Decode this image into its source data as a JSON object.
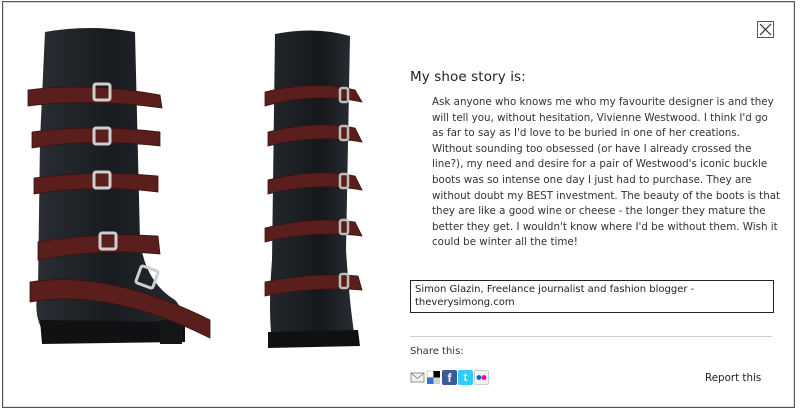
{
  "dialog": {
    "close_icon": "close-x-icon"
  },
  "story": {
    "heading": "My shoe story is:",
    "body": "Ask anyone who knows me who my favourite designer is and they will tell you, without hesitation, Vivienne Westwood. I think I'd go as far to say as I'd love to be buried in one of her creations. Without sounding too obsessed (or have I already crossed the line?), my need and desire for a pair of Westwood's iconic buckle boots was so intense one day I just had to purchase. They are without doubt my BEST investment. The beauty of the boots is that they are like a good wine or cheese - the longer they mature the better they get. I wouldn't know where I'd be without them. Wish it could be winter all the time!",
    "author": "Simon Glazin, Freelance journalist and fashion blogger - theverysimong.com"
  },
  "share": {
    "label": "Share this:",
    "icons": [
      "email-icon",
      "delicious-icon",
      "facebook-icon",
      "twitter-icon",
      "flickr-icon"
    ],
    "facebook_letter": "f",
    "twitter_letter": "t"
  },
  "report": {
    "label": "Report this"
  },
  "colors": {
    "boot_leather": "#1e2126",
    "strap": "#5a1f1c",
    "buckle": "#c9c9c9",
    "facebook": "#3b5998",
    "twitter": "#33ccff",
    "flickr_blue": "#0063dc",
    "flickr_pink": "#ff0084"
  }
}
